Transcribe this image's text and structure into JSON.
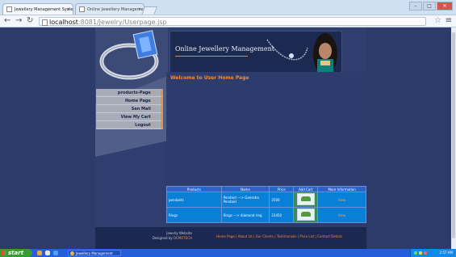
{
  "browser": {
    "tabs": [
      {
        "title": "Jewellery Management Syste",
        "active": true
      },
      {
        "title": "Online Jewellery Manageme",
        "active": false
      }
    ],
    "url_host": "localhost",
    "url_path": ":8081/Jewelry/Userpage.jsp",
    "back_icon": "back-arrow-icon",
    "forward_icon": "forward-arrow-icon",
    "reload_icon": "reload-icon",
    "window_controls": [
      "–",
      "□",
      "✕"
    ]
  },
  "site": {
    "banner_title": "Online Jewellery Management",
    "welcome": "Welcome to User Home Page",
    "menu": [
      {
        "label": "products-Page"
      },
      {
        "label": "Home Page"
      },
      {
        "label": "Sen Mail"
      },
      {
        "label": "View My Cart"
      },
      {
        "label": "Logout"
      }
    ],
    "menu_arrow": ">",
    "table": {
      "headers": [
        "Products",
        "Name",
        "Price",
        "Add Cart",
        "More Information"
      ],
      "rows": [
        {
          "product": "pendants",
          "name": "Pendant ---> Ganesha Pendant",
          "price": "2500",
          "more": "View"
        },
        {
          "product": "Rings",
          "name": "Rings ---> diamond ring",
          "price": "23450",
          "more": "View"
        }
      ]
    },
    "footer": {
      "line1": "Jewelry Website",
      "designed_by": "Designed by",
      "author": "DEMOTECH",
      "links": "Home Page | About Us | Our Clients | Testimonials | Price List | Contact Details"
    },
    "colors": {
      "accent": "#f28b3a",
      "page_bg": "#2c3b69",
      "table_cell": "#0a7fd8",
      "table_header": "#2a64c7"
    }
  },
  "taskbar": {
    "start_label": "start",
    "task_item": "Jewellery Management",
    "clock": "2:57 AM"
  }
}
